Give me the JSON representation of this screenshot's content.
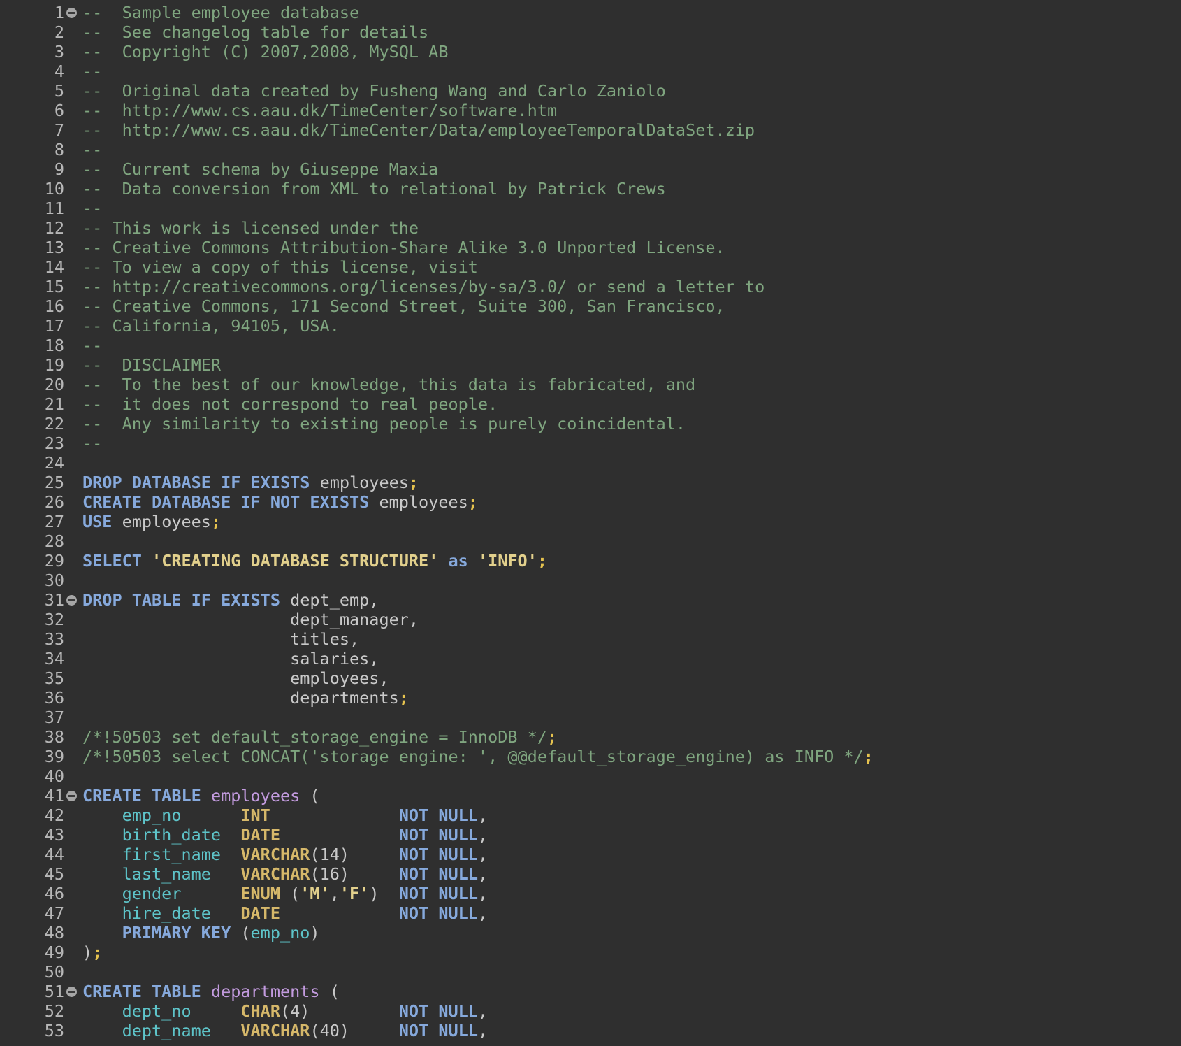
{
  "editor": {
    "language": "SQL",
    "token_colors": {
      "comment": "#7fa57f",
      "keyword": "#86a9dc",
      "identifier": "#c9c9c9",
      "punctuation": "#e6c34f",
      "string": "#e2d08c",
      "table_name": "#c39bdf",
      "column_name": "#5ec4c9",
      "data_type": "#d6b86a",
      "background": "#2f2f2f"
    },
    "lines": [
      {
        "n": "1",
        "fold": true,
        "tokens": [
          {
            "t": "--  Sample employee database",
            "c": "comment"
          }
        ]
      },
      {
        "n": "2",
        "tokens": [
          {
            "t": "--  See changelog table for details",
            "c": "comment"
          }
        ]
      },
      {
        "n": "3",
        "tokens": [
          {
            "t": "--  Copyright (C) 2007,2008, MySQL AB",
            "c": "comment"
          }
        ]
      },
      {
        "n": "4",
        "tokens": [
          {
            "t": "--",
            "c": "comment"
          }
        ]
      },
      {
        "n": "5",
        "tokens": [
          {
            "t": "--  Original data created by Fusheng Wang and Carlo Zaniolo",
            "c": "comment"
          }
        ]
      },
      {
        "n": "6",
        "tokens": [
          {
            "t": "--  http://www.cs.aau.dk/TimeCenter/software.htm",
            "c": "comment"
          }
        ]
      },
      {
        "n": "7",
        "tokens": [
          {
            "t": "--  http://www.cs.aau.dk/TimeCenter/Data/employeeTemporalDataSet.zip",
            "c": "comment"
          }
        ]
      },
      {
        "n": "8",
        "tokens": [
          {
            "t": "--",
            "c": "comment"
          }
        ]
      },
      {
        "n": "9",
        "tokens": [
          {
            "t": "--  Current schema by Giuseppe Maxia",
            "c": "comment"
          }
        ]
      },
      {
        "n": "10",
        "tokens": [
          {
            "t": "--  Data conversion from XML to relational by Patrick Crews",
            "c": "comment"
          }
        ]
      },
      {
        "n": "11",
        "tokens": [
          {
            "t": "--",
            "c": "comment"
          }
        ]
      },
      {
        "n": "12",
        "tokens": [
          {
            "t": "-- This work is licensed under the",
            "c": "comment"
          }
        ]
      },
      {
        "n": "13",
        "tokens": [
          {
            "t": "-- Creative Commons Attribution-Share Alike 3.0 Unported License.",
            "c": "comment"
          }
        ]
      },
      {
        "n": "14",
        "tokens": [
          {
            "t": "-- To view a copy of this license, visit",
            "c": "comment"
          }
        ]
      },
      {
        "n": "15",
        "tokens": [
          {
            "t": "-- http://creativecommons.org/licenses/by-sa/3.0/ or send a letter to",
            "c": "comment"
          }
        ]
      },
      {
        "n": "16",
        "tokens": [
          {
            "t": "-- Creative Commons, 171 Second Street, Suite 300, San Francisco,",
            "c": "comment"
          }
        ]
      },
      {
        "n": "17",
        "tokens": [
          {
            "t": "-- California, 94105, USA.",
            "c": "comment"
          }
        ]
      },
      {
        "n": "18",
        "tokens": [
          {
            "t": "--",
            "c": "comment"
          }
        ]
      },
      {
        "n": "19",
        "tokens": [
          {
            "t": "--  DISCLAIMER",
            "c": "comment"
          }
        ]
      },
      {
        "n": "20",
        "tokens": [
          {
            "t": "--  To the best of our knowledge, this data is fabricated, and",
            "c": "comment"
          }
        ]
      },
      {
        "n": "21",
        "tokens": [
          {
            "t": "--  it does not correspond to real people.",
            "c": "comment"
          }
        ]
      },
      {
        "n": "22",
        "tokens": [
          {
            "t": "--  Any similarity to existing people is purely coincidental.",
            "c": "comment"
          }
        ]
      },
      {
        "n": "23",
        "tokens": [
          {
            "t": "--",
            "c": "comment"
          }
        ]
      },
      {
        "n": "24",
        "tokens": []
      },
      {
        "n": "25",
        "tokens": [
          {
            "t": "DROP DATABASE IF EXISTS",
            "c": "kw"
          },
          {
            "t": " employees",
            "c": "plain"
          },
          {
            "t": ";",
            "c": "punct"
          }
        ]
      },
      {
        "n": "26",
        "tokens": [
          {
            "t": "CREATE DATABASE IF NOT EXISTS",
            "c": "kw"
          },
          {
            "t": " employees",
            "c": "plain"
          },
          {
            "t": ";",
            "c": "punct"
          }
        ]
      },
      {
        "n": "27",
        "tokens": [
          {
            "t": "USE",
            "c": "kw"
          },
          {
            "t": " employees",
            "c": "plain"
          },
          {
            "t": ";",
            "c": "punct"
          }
        ]
      },
      {
        "n": "28",
        "tokens": []
      },
      {
        "n": "29",
        "tokens": [
          {
            "t": "SELECT",
            "c": "kw"
          },
          {
            "t": " ",
            "c": "plain"
          },
          {
            "t": "'CREATING DATABASE STRUCTURE'",
            "c": "string"
          },
          {
            "t": " ",
            "c": "plain"
          },
          {
            "t": "as",
            "c": "kw"
          },
          {
            "t": " ",
            "c": "plain"
          },
          {
            "t": "'INFO'",
            "c": "string"
          },
          {
            "t": ";",
            "c": "punct"
          }
        ]
      },
      {
        "n": "30",
        "tokens": []
      },
      {
        "n": "31",
        "fold": true,
        "tokens": [
          {
            "t": "DROP TABLE IF EXISTS",
            "c": "kw"
          },
          {
            "t": " dept_emp,",
            "c": "plain"
          }
        ]
      },
      {
        "n": "32",
        "tokens": [
          {
            "t": "                     dept_manager,",
            "c": "plain"
          }
        ]
      },
      {
        "n": "33",
        "tokens": [
          {
            "t": "                     titles,",
            "c": "plain"
          }
        ]
      },
      {
        "n": "34",
        "tokens": [
          {
            "t": "                     salaries,",
            "c": "plain"
          }
        ]
      },
      {
        "n": "35",
        "tokens": [
          {
            "t": "                     employees,",
            "c": "plain"
          }
        ]
      },
      {
        "n": "36",
        "tokens": [
          {
            "t": "                     departments",
            "c": "plain"
          },
          {
            "t": ";",
            "c": "punct"
          }
        ]
      },
      {
        "n": "37",
        "tokens": []
      },
      {
        "n": "38",
        "tokens": [
          {
            "t": "/*!50503 set default_storage_engine = InnoDB */",
            "c": "comment"
          },
          {
            "t": ";",
            "c": "punct"
          }
        ]
      },
      {
        "n": "39",
        "tokens": [
          {
            "t": "/*!50503 select CONCAT('storage engine: ', @@default_storage_engine) as INFO */",
            "c": "comment"
          },
          {
            "t": ";",
            "c": "punct"
          }
        ]
      },
      {
        "n": "40",
        "tokens": []
      },
      {
        "n": "41",
        "fold": true,
        "tokens": [
          {
            "t": "CREATE TABLE",
            "c": "kw"
          },
          {
            "t": " ",
            "c": "plain"
          },
          {
            "t": "employees",
            "c": "table"
          },
          {
            "t": " (",
            "c": "plain"
          }
        ]
      },
      {
        "n": "42",
        "tokens": [
          {
            "t": "    ",
            "c": "plain"
          },
          {
            "t": "emp_no",
            "c": "col"
          },
          {
            "t": "      ",
            "c": "plain"
          },
          {
            "t": "INT",
            "c": "type"
          },
          {
            "t": "             ",
            "c": "plain"
          },
          {
            "t": "NOT NULL",
            "c": "kw"
          },
          {
            "t": ",",
            "c": "plain"
          }
        ]
      },
      {
        "n": "43",
        "tokens": [
          {
            "t": "    ",
            "c": "plain"
          },
          {
            "t": "birth_date",
            "c": "col"
          },
          {
            "t": "  ",
            "c": "plain"
          },
          {
            "t": "DATE",
            "c": "type"
          },
          {
            "t": "            ",
            "c": "plain"
          },
          {
            "t": "NOT NULL",
            "c": "kw"
          },
          {
            "t": ",",
            "c": "plain"
          }
        ]
      },
      {
        "n": "44",
        "tokens": [
          {
            "t": "    ",
            "c": "plain"
          },
          {
            "t": "first_name",
            "c": "col"
          },
          {
            "t": "  ",
            "c": "plain"
          },
          {
            "t": "VARCHAR",
            "c": "type"
          },
          {
            "t": "(14)     ",
            "c": "plain"
          },
          {
            "t": "NOT NULL",
            "c": "kw"
          },
          {
            "t": ",",
            "c": "plain"
          }
        ]
      },
      {
        "n": "45",
        "tokens": [
          {
            "t": "    ",
            "c": "plain"
          },
          {
            "t": "last_name",
            "c": "col"
          },
          {
            "t": "   ",
            "c": "plain"
          },
          {
            "t": "VARCHAR",
            "c": "type"
          },
          {
            "t": "(16)     ",
            "c": "plain"
          },
          {
            "t": "NOT NULL",
            "c": "kw"
          },
          {
            "t": ",",
            "c": "plain"
          }
        ]
      },
      {
        "n": "46",
        "tokens": [
          {
            "t": "    ",
            "c": "plain"
          },
          {
            "t": "gender",
            "c": "col"
          },
          {
            "t": "      ",
            "c": "plain"
          },
          {
            "t": "ENUM",
            "c": "type"
          },
          {
            "t": " (",
            "c": "plain"
          },
          {
            "t": "'M'",
            "c": "string"
          },
          {
            "t": ",",
            "c": "plain"
          },
          {
            "t": "'F'",
            "c": "string"
          },
          {
            "t": ")  ",
            "c": "plain"
          },
          {
            "t": "NOT NULL",
            "c": "kw"
          },
          {
            "t": ",",
            "c": "plain"
          }
        ]
      },
      {
        "n": "47",
        "tokens": [
          {
            "t": "    ",
            "c": "plain"
          },
          {
            "t": "hire_date",
            "c": "col"
          },
          {
            "t": "   ",
            "c": "plain"
          },
          {
            "t": "DATE",
            "c": "type"
          },
          {
            "t": "            ",
            "c": "plain"
          },
          {
            "t": "NOT NULL",
            "c": "kw"
          },
          {
            "t": ",",
            "c": "plain"
          }
        ]
      },
      {
        "n": "48",
        "tokens": [
          {
            "t": "    ",
            "c": "plain"
          },
          {
            "t": "PRIMARY KEY",
            "c": "kw"
          },
          {
            "t": " (",
            "c": "plain"
          },
          {
            "t": "emp_no",
            "c": "col"
          },
          {
            "t": ")",
            "c": "plain"
          }
        ]
      },
      {
        "n": "49",
        "tokens": [
          {
            "t": ")",
            "c": "plain"
          },
          {
            "t": ";",
            "c": "punct"
          }
        ]
      },
      {
        "n": "50",
        "tokens": []
      },
      {
        "n": "51",
        "fold": true,
        "tokens": [
          {
            "t": "CREATE TABLE",
            "c": "kw"
          },
          {
            "t": " ",
            "c": "plain"
          },
          {
            "t": "departments",
            "c": "table"
          },
          {
            "t": " (",
            "c": "plain"
          }
        ]
      },
      {
        "n": "52",
        "tokens": [
          {
            "t": "    ",
            "c": "plain"
          },
          {
            "t": "dept_no",
            "c": "col"
          },
          {
            "t": "     ",
            "c": "plain"
          },
          {
            "t": "CHAR",
            "c": "type"
          },
          {
            "t": "(4)         ",
            "c": "plain"
          },
          {
            "t": "NOT NULL",
            "c": "kw"
          },
          {
            "t": ",",
            "c": "plain"
          }
        ]
      },
      {
        "n": "53",
        "tokens": [
          {
            "t": "    ",
            "c": "plain"
          },
          {
            "t": "dept_name",
            "c": "col"
          },
          {
            "t": "   ",
            "c": "plain"
          },
          {
            "t": "VARCHAR",
            "c": "type"
          },
          {
            "t": "(40)     ",
            "c": "plain"
          },
          {
            "t": "NOT NULL",
            "c": "kw"
          },
          {
            "t": ",",
            "c": "plain"
          }
        ]
      }
    ]
  }
}
